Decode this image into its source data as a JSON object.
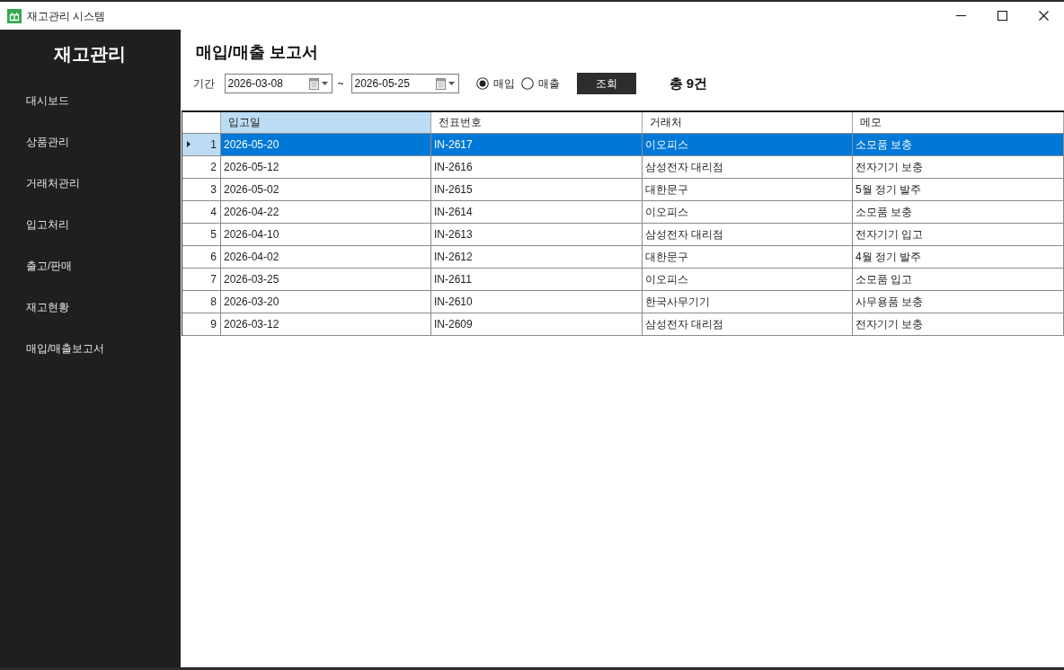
{
  "window": {
    "title": "재고관리 시스템"
  },
  "sidebar": {
    "title": "재고관리",
    "items": [
      {
        "label": "대시보드"
      },
      {
        "label": "상품관리"
      },
      {
        "label": "거래처관리"
      },
      {
        "label": "입고처리"
      },
      {
        "label": "출고/판매"
      },
      {
        "label": "재고현황"
      },
      {
        "label": "매입/매출보고서"
      }
    ]
  },
  "report": {
    "title": "매입/매출 보고서",
    "filter": {
      "label": "기간",
      "date_from": "2026-03-08",
      "separator": "~",
      "date_to": "2026-05-25",
      "types": [
        {
          "label": "매입",
          "selected": true
        },
        {
          "label": "매출",
          "selected": false
        }
      ],
      "button": "조회",
      "total": "총 9건"
    }
  },
  "table": {
    "columns": [
      {
        "label": "입고일",
        "selected": true
      },
      {
        "label": "전표번호",
        "selected": false
      },
      {
        "label": "거래처",
        "selected": false
      },
      {
        "label": "메모",
        "selected": false
      }
    ],
    "rows": [
      {
        "number": "1",
        "selected": true,
        "cells": [
          "2026-05-20",
          "IN-2617",
          "이오피스",
          "소모품 보충"
        ]
      },
      {
        "number": "2",
        "selected": false,
        "cells": [
          "2026-05-12",
          "IN-2616",
          "삼성전자 대리점",
          "전자기기 보충"
        ]
      },
      {
        "number": "3",
        "selected": false,
        "cells": [
          "2026-05-02",
          "IN-2615",
          "대한문구",
          "5월 정기 발주"
        ]
      },
      {
        "number": "4",
        "selected": false,
        "cells": [
          "2026-04-22",
          "IN-2614",
          "이오피스",
          "소모품 보충"
        ]
      },
      {
        "number": "5",
        "selected": false,
        "cells": [
          "2026-04-10",
          "IN-2613",
          "삼성전자 대리점",
          "전자기기 입고"
        ]
      },
      {
        "number": "6",
        "selected": false,
        "cells": [
          "2026-04-02",
          "IN-2612",
          "대한문구",
          "4월 정기 발주"
        ]
      },
      {
        "number": "7",
        "selected": false,
        "cells": [
          "2026-03-25",
          "IN-2611",
          "이오피스",
          "소모품 입고"
        ]
      },
      {
        "number": "8",
        "selected": false,
        "cells": [
          "2026-03-20",
          "IN-2610",
          "한국사무기기",
          "사무용품 보충"
        ]
      },
      {
        "number": "9",
        "selected": false,
        "cells": [
          "2026-03-12",
          "IN-2609",
          "삼성전자 대리점",
          "전자기기 보충"
        ]
      }
    ]
  }
}
